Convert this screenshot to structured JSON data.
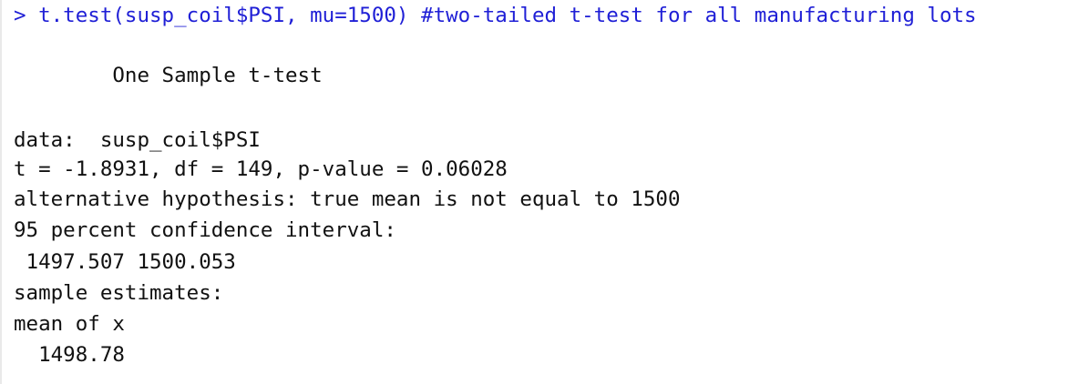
{
  "console": {
    "command": "> t.test(susp_coil$PSI, mu=1500) #two-tailed t-test for all manufacturing lots",
    "output": [
      "        One Sample t-test",
      "data:  susp_coil$PSI",
      "t = -1.8931, df = 149, p-value = 0.06028",
      "alternative hypothesis: true mean is not equal to 1500",
      "95 percent confidence interval:",
      " 1497.507 1500.053",
      "sample estimates:",
      "mean of x",
      "  1498.78"
    ]
  },
  "colors": {
    "command": "#1f1fd6",
    "output": "#111111",
    "background": "#ffffff"
  }
}
